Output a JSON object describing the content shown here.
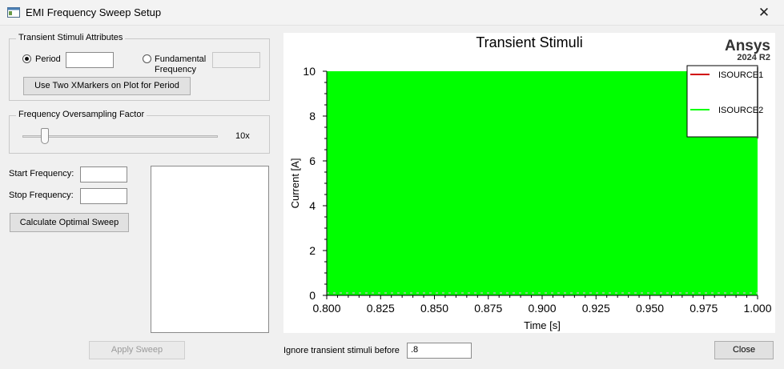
{
  "window": {
    "title": "EMI Frequency Sweep Setup",
    "icon": "app-window-icon",
    "close_glyph": "✕"
  },
  "transient_group": {
    "title": "Transient Stimuli Attributes",
    "period_label": "Period",
    "period_value": "",
    "period_selected": true,
    "fundamental_label": "Fundamental Frequency",
    "fundamental_value": "",
    "fundamental_selected": false,
    "xmarkers_button": "Use Two XMarkers on Plot for Period"
  },
  "oversampling_group": {
    "title": "Frequency Oversampling Factor",
    "value_label": "10x",
    "slider_level": 0.12
  },
  "sweep": {
    "start_label": "Start Frequency:",
    "start_value": "",
    "stop_label": "Stop Frequency:",
    "stop_value": "",
    "calculate_button": "Calculate Optimal Sweep",
    "results": []
  },
  "apply_button": "Apply Sweep",
  "ignore_label": "Ignore transient stimuli before",
  "ignore_value": ".8",
  "close_button": "Close",
  "colors": {
    "isource1": "#d10000",
    "isource2": "#00ff00",
    "plot_bg": "#ffffff"
  },
  "chart_data": {
    "type": "area",
    "title": "Transient Stimuli",
    "brand": "Ansys",
    "version": "2024 R2",
    "xlabel": "Time [s]",
    "ylabel": "Current [A]",
    "xlim": [
      0.8,
      1.0
    ],
    "ylim": [
      0,
      10
    ],
    "x_ticks": [
      "0.800",
      "0.825",
      "0.850",
      "0.875",
      "0.900",
      "0.925",
      "0.950",
      "0.975",
      "1.000"
    ],
    "y_ticks": [
      "0",
      "2",
      "4",
      "6",
      "8",
      "10"
    ],
    "grid": false,
    "legend_position": "top-right",
    "series": [
      {
        "name": "ISOURCE1",
        "color": "#d10000",
        "min": 0,
        "max": 10
      },
      {
        "name": "ISOURCE2",
        "color": "#00ff00",
        "min": 0,
        "max": 10
      }
    ]
  }
}
